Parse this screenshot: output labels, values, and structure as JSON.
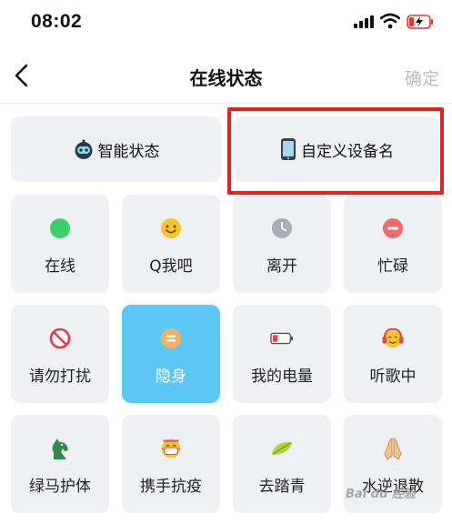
{
  "status_bar": {
    "time": "08:02"
  },
  "nav": {
    "title": "在线状态",
    "confirm_label": "确定"
  },
  "top_options": [
    {
      "label": "智能状态",
      "icon": "robot-icon"
    },
    {
      "label": "自定义设备名",
      "icon": "phone-icon"
    }
  ],
  "statuses": [
    {
      "label": "在线",
      "icon": "green-dot-icon"
    },
    {
      "label": "Q我吧",
      "icon": "smiley-icon"
    },
    {
      "label": "离开",
      "icon": "clock-icon"
    },
    {
      "label": "忙碌",
      "icon": "minus-circle-icon"
    },
    {
      "label": "请勿打扰",
      "icon": "no-entry-icon"
    },
    {
      "label": "隐身",
      "icon": "equals-circle-icon",
      "selected": true
    },
    {
      "label": "我的电量",
      "icon": "battery-icon"
    },
    {
      "label": "听歌中",
      "icon": "headphones-face-icon"
    },
    {
      "label": "绿马护体",
      "icon": "green-horse-icon"
    },
    {
      "label": "携手抗疫",
      "icon": "mask-face-icon"
    },
    {
      "label": "去踏青",
      "icon": "leaf-icon"
    },
    {
      "label": "水逆退散",
      "icon": "praying-hands-icon"
    }
  ],
  "watermark": {
    "text": "Bai du 经验"
  },
  "colors": {
    "selected": "#5cc6f4",
    "tile": "#eff0f3",
    "highlight": "#e8201f",
    "confirm_disabled": "#b9bcc4"
  }
}
